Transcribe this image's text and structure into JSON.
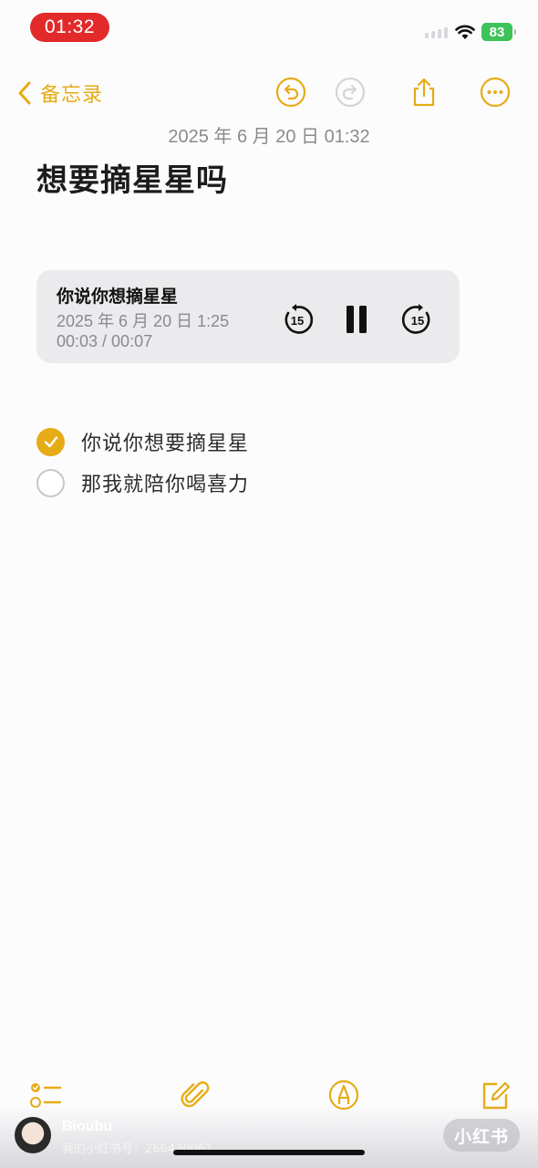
{
  "status_bar": {
    "time": "01:32",
    "battery": "83"
  },
  "nav": {
    "back_label": "备忘录",
    "icons": [
      "undo-icon",
      "redo-icon",
      "share-icon",
      "more-icon"
    ]
  },
  "note": {
    "date": "2025 年 6 月 20 日 01:32",
    "title": "想要摘星星吗"
  },
  "audio": {
    "title": "你说你想摘星星",
    "recorded": "2025 年 6 月 20 日 1:25",
    "elapsed": "00:03",
    "total": "00:07",
    "progress_text": "00:03 / 00:07",
    "skip_back_label": "15",
    "skip_forward_label": "15",
    "state": "playing"
  },
  "checklist": [
    {
      "text": "你说你想要摘星星",
      "checked": true
    },
    {
      "text": "那我就陪你喝喜力",
      "checked": false
    }
  ],
  "toolbar": {
    "icons": [
      "checklist-icon",
      "attachment-icon",
      "markup-icon",
      "compose-icon"
    ]
  },
  "watermark": {
    "name": "Bioubu",
    "id_text": "我的小红书号：266430061",
    "logo": "小红书"
  },
  "colors": {
    "accent": "#e6ac16",
    "status_time_bg": "#e22a2a",
    "battery": "#3ec25a",
    "card_bg": "#ebebed"
  }
}
